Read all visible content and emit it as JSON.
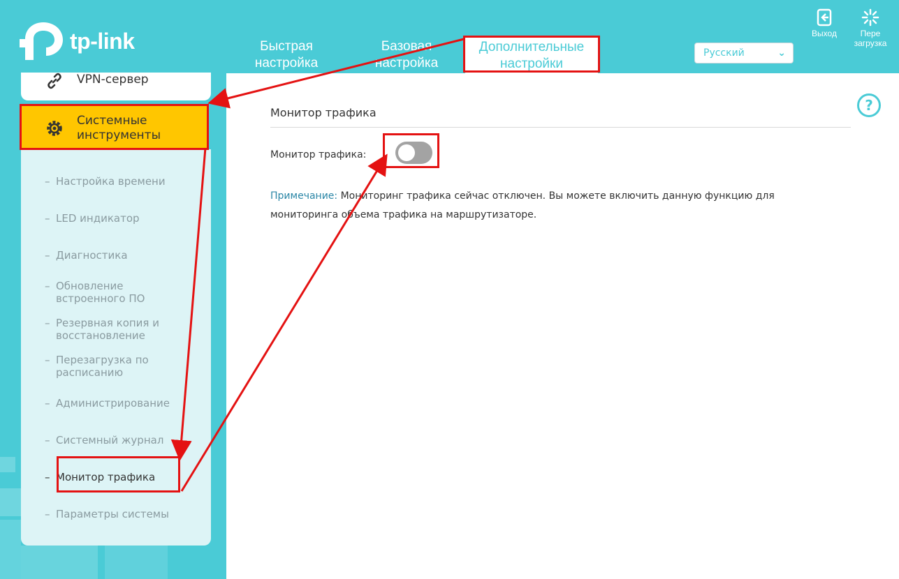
{
  "brand": {
    "logo_text": "tp-link"
  },
  "header": {
    "tabs": [
      {
        "line1": "Быстрая",
        "line2": "настройка"
      },
      {
        "line1": "Базовая",
        "line2": "настройка"
      },
      {
        "line1": "Дополнительные",
        "line2": "настройки"
      }
    ],
    "language": "Русский",
    "logout_label": "Выход",
    "reboot_label_1": "Пере",
    "reboot_label_2": "загрузка"
  },
  "sidebar": {
    "vpn_label": "VPN-сервер",
    "system_tools_line1": "Системные",
    "system_tools_line2": "инструменты",
    "items": [
      {
        "text": "Настройка времени"
      },
      {
        "text": "LED индикатор"
      },
      {
        "text": "Диагностика"
      },
      {
        "text": "Обновление встроенного ПО"
      },
      {
        "text": "Резервная копия и восстановление"
      },
      {
        "text": "Перезагрузка по расписанию"
      },
      {
        "text": "Администрирование"
      },
      {
        "text": "Системный журнал"
      },
      {
        "text": "Монитор трафика"
      },
      {
        "text": "Параметры системы"
      }
    ],
    "dash": "–"
  },
  "content": {
    "section_title": "Монитор трафика",
    "field_label": "Монитор трафика:",
    "toggle_on": false,
    "note_label": "Примечание:",
    "note_text": "Мониторинг трафика сейчас отключен. Вы можете включить данную функцию для мониторинга объема трафика на маршрутизаторе.",
    "help_glyph": "?"
  },
  "colors": {
    "brand_teal": "#4acbd6",
    "active_orange": "#ffc600",
    "annotation_red": "#e41212"
  }
}
